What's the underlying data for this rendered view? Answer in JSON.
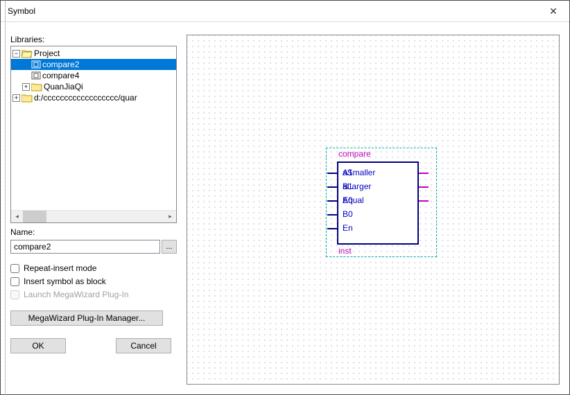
{
  "window": {
    "title": "Symbol"
  },
  "labels": {
    "libraries": "Libraries:",
    "name": "Name:"
  },
  "tree": {
    "root": {
      "label": "Project",
      "expanded": true
    },
    "children": [
      {
        "label": "compare2",
        "type": "file",
        "selected": true
      },
      {
        "label": "compare4",
        "type": "file",
        "selected": false
      },
      {
        "label": "QuanJiaQi",
        "type": "folder",
        "expanded": false
      }
    ],
    "sibling": {
      "label": "d:/cccccccccccccccccc/quar",
      "expanded": false
    }
  },
  "name_field": {
    "value": "compare2",
    "browse": "..."
  },
  "checks": {
    "repeat": "Repeat-insert mode",
    "block": "Insert symbol as block",
    "mega": "Launch MegaWizard Plug-In"
  },
  "buttons": {
    "megawizard": "MegaWizard Plug-In Manager...",
    "ok": "OK",
    "cancel": "Cancel"
  },
  "symbol": {
    "title": "compare",
    "instance": "inst",
    "left_pins": [
      "A1",
      "B1",
      "A0",
      "B0",
      "En"
    ],
    "right_pins": [
      "aSmaller",
      "aLarger",
      "Equal"
    ]
  }
}
